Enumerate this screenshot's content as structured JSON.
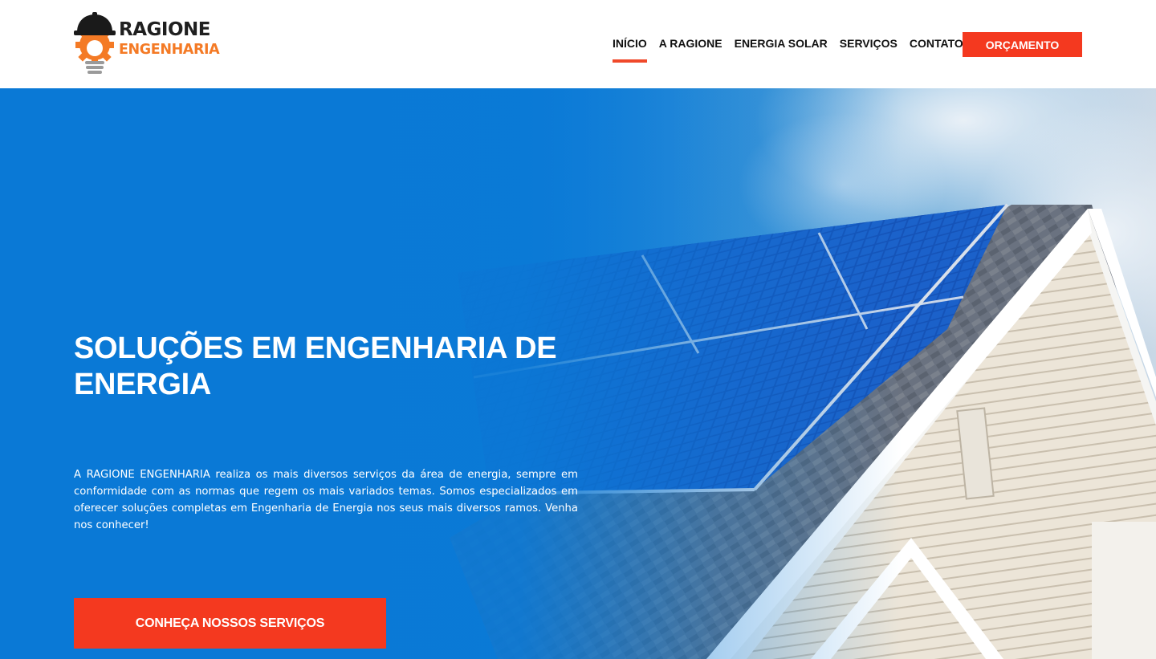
{
  "brand": {
    "name_line1": "RAGIONE",
    "name_line2": "ENGENHARIA",
    "colors": {
      "dark": "#1f1f1f",
      "orange": "#f47a25",
      "accent_red": "#f4391f",
      "hero_blue": "#0a79d6"
    }
  },
  "nav": {
    "items": [
      {
        "label": "INÍCIO",
        "active": true
      },
      {
        "label": "A RAGIONE",
        "active": false
      },
      {
        "label": "ENERGIA SOLAR",
        "active": false
      },
      {
        "label": "SERVIÇOS",
        "active": false
      },
      {
        "label": "CONTATO",
        "active": false
      }
    ],
    "cta_label": "ORÇAMENTO"
  },
  "hero": {
    "title": "SOLUÇÕES EM ENGENHARIA DE ENERGIA",
    "text": "A RAGIONE ENGENHARIA realiza os mais diversos serviços da área de energia, sempre em conformidade com as normas que regem os mais variados temas. Somos especializados em oferecer soluções completas em Engenharia de Energia nos seus mais diversos ramos. Venha nos conhecer!",
    "button_label": "CONHEÇA NOSSOS SERVIÇOS",
    "image_subject": "solar-panels-on-house-roof"
  }
}
